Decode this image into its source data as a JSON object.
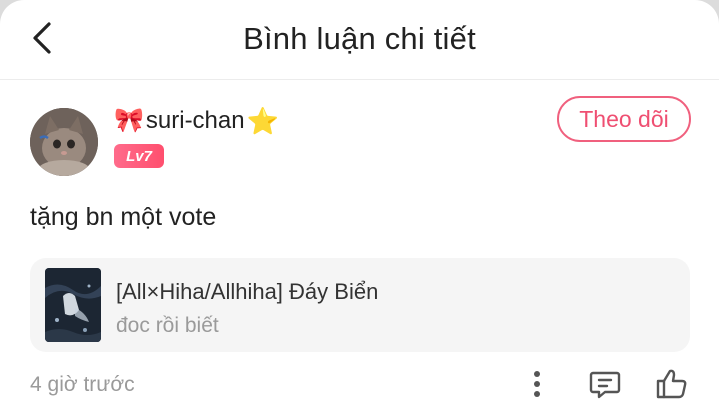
{
  "header": {
    "title": "Bình luận chi tiết"
  },
  "author": {
    "name_prefix_emoji": "🎀",
    "name": "suri-chan",
    "name_suffix_emoji": "⭐",
    "level": "Lv7",
    "follow_label": "Theo dõi"
  },
  "comment": {
    "text": "tặng bn một vote"
  },
  "book": {
    "title": "[All×Hiha/Allhiha] Đáy Biển",
    "subtitle": "đoc rồi biết"
  },
  "footer": {
    "timestamp": "4 giờ trước"
  },
  "icons": {
    "back": "chevron-left-icon",
    "more": "more-vertical-icon",
    "reply": "comment-icon",
    "like": "thumbs-up-icon"
  },
  "colors": {
    "accent": "#ef4f72",
    "badge": "#ff5a78",
    "muted_text": "#9a9a9a",
    "card_bg": "#f5f5f5"
  }
}
